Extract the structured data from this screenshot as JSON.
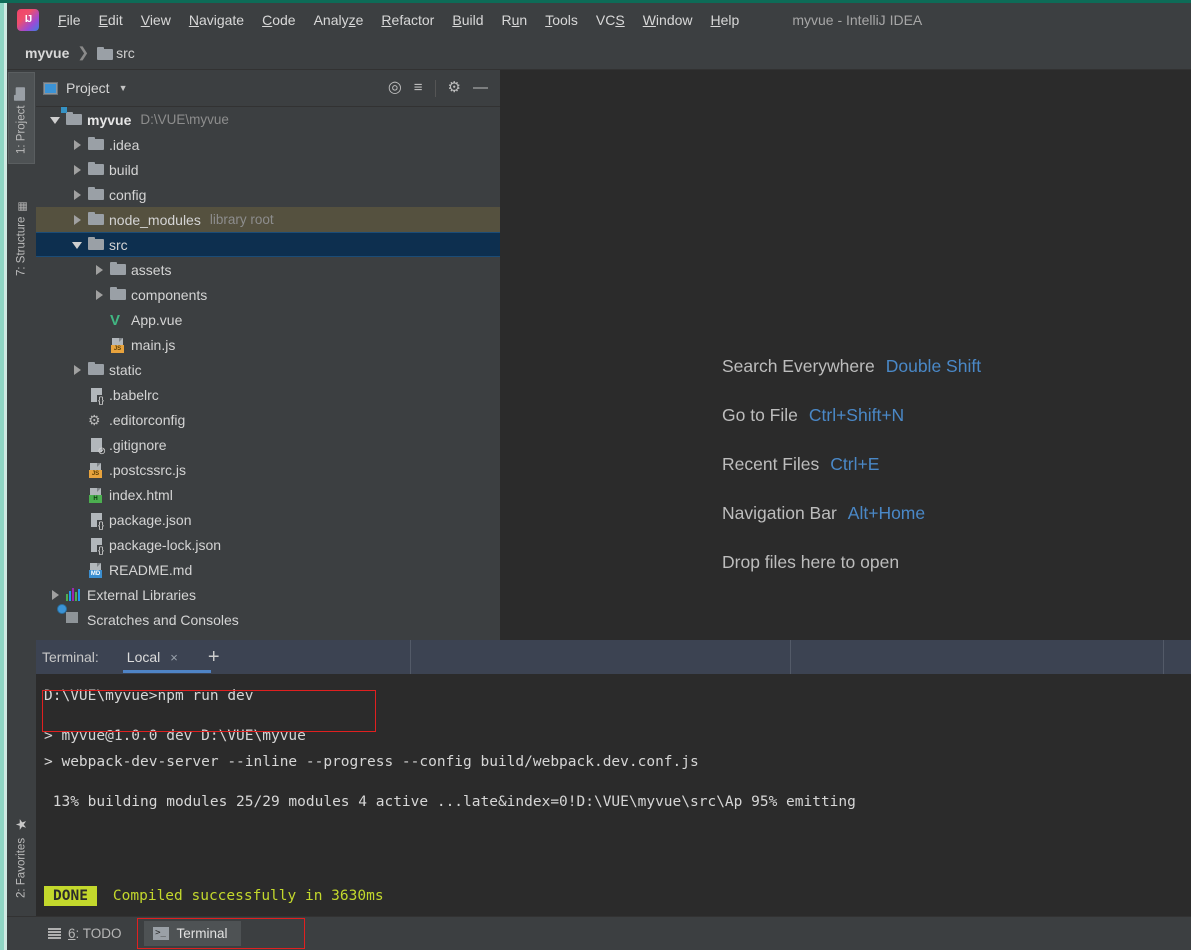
{
  "window": {
    "title": "myvue - IntelliJ IDEA",
    "logo_label": "IJ",
    "accent_blue": "#4a88c7",
    "selection_blue": "#0d2f4f",
    "library_olive": "#55513f",
    "annotation_red": "#e02020",
    "done_green": "#c3d82c"
  },
  "menu": {
    "items": [
      {
        "before": "",
        "mnemonic": "F",
        "after": "ile"
      },
      {
        "before": "",
        "mnemonic": "E",
        "after": "dit"
      },
      {
        "before": "",
        "mnemonic": "V",
        "after": "iew"
      },
      {
        "before": "",
        "mnemonic": "N",
        "after": "avigate"
      },
      {
        "before": "",
        "mnemonic": "C",
        "after": "ode"
      },
      {
        "before": "Analy",
        "mnemonic": "z",
        "after": "e"
      },
      {
        "before": "",
        "mnemonic": "R",
        "after": "efactor"
      },
      {
        "before": "",
        "mnemonic": "B",
        "after": "uild"
      },
      {
        "before": "R",
        "mnemonic": "u",
        "after": "n"
      },
      {
        "before": "",
        "mnemonic": "T",
        "after": "ools"
      },
      {
        "before": "VC",
        "mnemonic": "S",
        "after": ""
      },
      {
        "before": "",
        "mnemonic": "W",
        "after": "indow"
      },
      {
        "before": "",
        "mnemonic": "H",
        "after": "elp"
      }
    ]
  },
  "breadcrumb": {
    "root": "myvue",
    "separator": "❯",
    "current": "src"
  },
  "left_strip": {
    "tabs": [
      {
        "label": "1: Project",
        "icon": "folder-icon",
        "active": true
      },
      {
        "label": "7: Structure",
        "icon": "structure-icon",
        "active": false
      }
    ],
    "bottom_tabs": [
      {
        "label": "2: Favorites",
        "icon": "star-icon",
        "active": false
      }
    ]
  },
  "project_panel": {
    "title": "Project",
    "caret": "▼",
    "tools": [
      {
        "name": "locate-icon",
        "glyph": "⊕"
      },
      {
        "name": "collapse-all-icon",
        "glyph": "≅"
      },
      {
        "name": "settings-gear-icon",
        "glyph": "⚙"
      },
      {
        "name": "hide-panel-icon",
        "glyph": "—"
      }
    ],
    "tree": [
      {
        "indent": 0,
        "arrow": "open",
        "icon": "module-folder-icon",
        "label": "myvue",
        "bold": true,
        "hint": "D:\\VUE\\myvue",
        "state": ""
      },
      {
        "indent": 1,
        "arrow": "closed",
        "icon": "folder-icon",
        "label": ".idea",
        "bold": false,
        "hint": "",
        "state": ""
      },
      {
        "indent": 1,
        "arrow": "closed",
        "icon": "folder-icon",
        "label": "build",
        "bold": false,
        "hint": "",
        "state": ""
      },
      {
        "indent": 1,
        "arrow": "closed",
        "icon": "folder-icon",
        "label": "config",
        "bold": false,
        "hint": "",
        "state": ""
      },
      {
        "indent": 1,
        "arrow": "closed",
        "icon": "folder-icon",
        "label": "node_modules",
        "bold": false,
        "hint": "library root",
        "state": "lib"
      },
      {
        "indent": 1,
        "arrow": "open",
        "icon": "folder-icon",
        "label": "src",
        "bold": false,
        "hint": "",
        "state": "sel"
      },
      {
        "indent": 2,
        "arrow": "closed",
        "icon": "folder-icon",
        "label": "assets",
        "bold": false,
        "hint": "",
        "state": ""
      },
      {
        "indent": 2,
        "arrow": "closed",
        "icon": "folder-icon",
        "label": "components",
        "bold": false,
        "hint": "",
        "state": ""
      },
      {
        "indent": 2,
        "arrow": "none",
        "icon": "vue-file-icon",
        "label": "App.vue",
        "bold": false,
        "hint": "",
        "state": ""
      },
      {
        "indent": 2,
        "arrow": "none",
        "icon": "js-file-icon",
        "label": "main.js",
        "bold": false,
        "hint": "",
        "state": ""
      },
      {
        "indent": 1,
        "arrow": "closed",
        "icon": "folder-icon",
        "label": "static",
        "bold": false,
        "hint": "",
        "state": ""
      },
      {
        "indent": 1,
        "arrow": "none",
        "icon": "json-file-icon",
        "label": ".babelrc",
        "bold": false,
        "hint": "",
        "state": ""
      },
      {
        "indent": 1,
        "arrow": "none",
        "icon": "editorconfig-icon",
        "label": ".editorconfig",
        "bold": false,
        "hint": "",
        "state": ""
      },
      {
        "indent": 1,
        "arrow": "none",
        "icon": "gitignore-icon",
        "label": ".gitignore",
        "bold": false,
        "hint": "",
        "state": ""
      },
      {
        "indent": 1,
        "arrow": "none",
        "icon": "js-file-icon",
        "label": ".postcssrc.js",
        "bold": false,
        "hint": "",
        "state": ""
      },
      {
        "indent": 1,
        "arrow": "none",
        "icon": "html-file-icon",
        "label": "index.html",
        "bold": false,
        "hint": "",
        "state": ""
      },
      {
        "indent": 1,
        "arrow": "none",
        "icon": "json-file-icon",
        "label": "package.json",
        "bold": false,
        "hint": "",
        "state": ""
      },
      {
        "indent": 1,
        "arrow": "none",
        "icon": "json-file-icon",
        "label": "package-lock.json",
        "bold": false,
        "hint": "",
        "state": ""
      },
      {
        "indent": 1,
        "arrow": "none",
        "icon": "md-file-icon",
        "label": "README.md",
        "bold": false,
        "hint": "",
        "state": ""
      },
      {
        "indent": 0,
        "arrow": "closed",
        "icon": "external-libraries-icon",
        "label": "External Libraries",
        "bold": false,
        "hint": "",
        "state": ""
      },
      {
        "indent": 0,
        "arrow": "none",
        "icon": "scratches-icon",
        "label": "Scratches and Consoles",
        "bold": false,
        "hint": "",
        "state": ""
      }
    ]
  },
  "editor": {
    "hints": [
      {
        "label": "Search Everywhere",
        "key": "Double Shift"
      },
      {
        "label": "Go to File",
        "key": "Ctrl+Shift+N"
      },
      {
        "label": "Recent Files",
        "key": "Ctrl+E"
      },
      {
        "label": "Navigation Bar",
        "key": "Alt+Home"
      },
      {
        "label": "Drop files here to open",
        "key": ""
      }
    ]
  },
  "terminal": {
    "header_label": "Terminal:",
    "tab_label": "Local",
    "tab_close": "×",
    "add_tab": "+",
    "lines": [
      {
        "text": "D:\\VUE\\myvue>npm run dev",
        "style": "plain",
        "annotated": true
      },
      {
        "text": "",
        "style": "plain",
        "annotated": false
      },
      {
        "text": "> myvue@1.0.0 dev D:\\VUE\\myvue",
        "style": "plain",
        "annotated": false
      },
      {
        "text": "> webpack-dev-server --inline --progress --config build/webpack.dev.conf.js",
        "style": "plain",
        "annotated": false
      },
      {
        "text": "",
        "style": "plain",
        "annotated": false
      },
      {
        "text": " 13% building modules 25/29 modules 4 active ...late&index=0!D:\\VUE\\myvue\\src\\Ap 95% emitting",
        "style": "plain",
        "annotated": false
      }
    ],
    "done_badge": "DONE",
    "done_message": "Compiled successfully in 3630ms"
  },
  "status_bar": {
    "todo": {
      "prefix": "",
      "mnemonic": "6",
      "suffix": ": TODO"
    },
    "terminal": "Terminal"
  }
}
